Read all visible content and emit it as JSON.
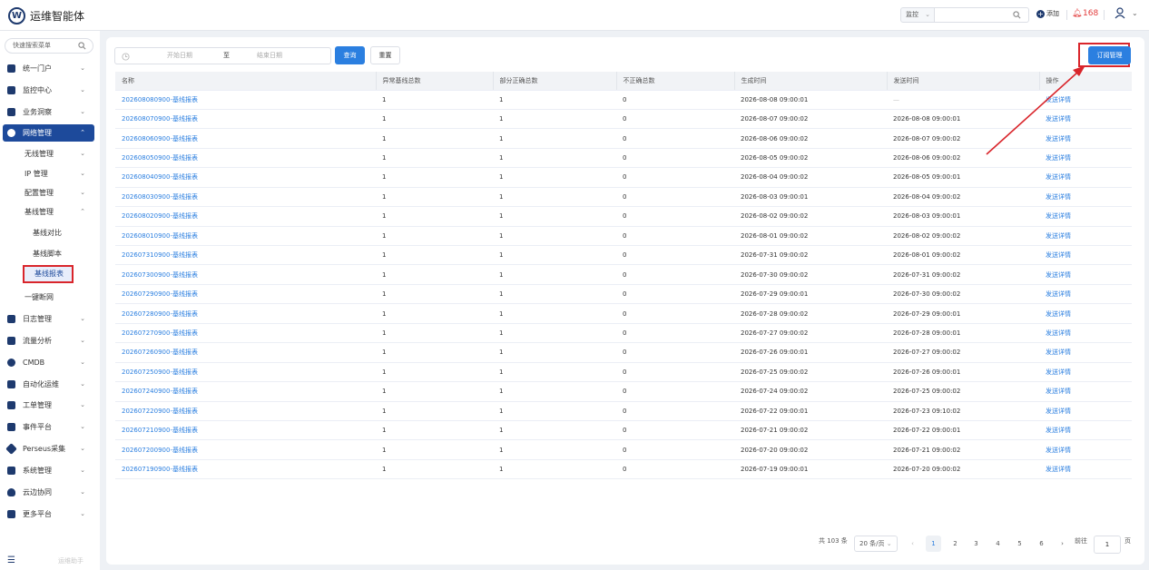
{
  "app": {
    "logo_letter": "W",
    "title": "运维智能体"
  },
  "header": {
    "monitor_select": "监控",
    "search_placeholder": "",
    "add_label": "添加",
    "alarm_count": "168"
  },
  "sidebar": {
    "search_placeholder": "快速搜索菜单",
    "items": [
      {
        "label": "统一门户"
      },
      {
        "label": "监控中心"
      },
      {
        "label": "业务洞察"
      },
      {
        "label": "网络管理"
      },
      {
        "label": "日志管理"
      },
      {
        "label": "流量分析"
      },
      {
        "label": "CMDB"
      },
      {
        "label": "自动化运维"
      },
      {
        "label": "工单管理"
      },
      {
        "label": "事件平台"
      },
      {
        "label": "Perseus采集"
      },
      {
        "label": "系统管理"
      },
      {
        "label": "云边协同"
      },
      {
        "label": "更多平台"
      }
    ],
    "network_sub": [
      {
        "label": "无线管理"
      },
      {
        "label": "IP 管理"
      },
      {
        "label": "配置管理"
      },
      {
        "label": "基线管理"
      }
    ],
    "baseline_sub": [
      {
        "label": "基线对比"
      },
      {
        "label": "基线脚本"
      },
      {
        "label": "基线报表"
      }
    ],
    "one_click": "一键断网",
    "bottom_text": "运维助手"
  },
  "filters": {
    "start_placeholder": "开始日期",
    "to_label": "至",
    "end_placeholder": "结束日期",
    "query_label": "查询",
    "reset_label": "重置",
    "subscribe_label": "订阅管理"
  },
  "table": {
    "headers": [
      "名称",
      "异常基线总数",
      "部分正确总数",
      "不正确总数",
      "生成时间",
      "发送时间",
      "操作"
    ],
    "rows": [
      [
        "202608080900-基线报表",
        "1",
        "1",
        "0",
        "2026-08-08 09:00:01",
        "—",
        "发送详情"
      ],
      [
        "202608070900-基线报表",
        "1",
        "1",
        "0",
        "2026-08-07 09:00:02",
        "2026-08-08 09:00:01",
        "发送详情"
      ],
      [
        "202608060900-基线报表",
        "1",
        "1",
        "0",
        "2026-08-06 09:00:02",
        "2026-08-07 09:00:02",
        "发送详情"
      ],
      [
        "202608050900-基线报表",
        "1",
        "1",
        "0",
        "2026-08-05 09:00:02",
        "2026-08-06 09:00:02",
        "发送详情"
      ],
      [
        "202608040900-基线报表",
        "1",
        "1",
        "0",
        "2026-08-04 09:00:02",
        "2026-08-05 09:00:01",
        "发送详情"
      ],
      [
        "202608030900-基线报表",
        "1",
        "1",
        "0",
        "2026-08-03 09:00:01",
        "2026-08-04 09:00:02",
        "发送详情"
      ],
      [
        "202608020900-基线报表",
        "1",
        "1",
        "0",
        "2026-08-02 09:00:02",
        "2026-08-03 09:00:01",
        "发送详情"
      ],
      [
        "202608010900-基线报表",
        "1",
        "1",
        "0",
        "2026-08-01 09:00:02",
        "2026-08-02 09:00:02",
        "发送详情"
      ],
      [
        "202607310900-基线报表",
        "1",
        "1",
        "0",
        "2026-07-31 09:00:02",
        "2026-08-01 09:00:02",
        "发送详情"
      ],
      [
        "202607300900-基线报表",
        "1",
        "1",
        "0",
        "2026-07-30 09:00:02",
        "2026-07-31 09:00:02",
        "发送详情"
      ],
      [
        "202607290900-基线报表",
        "1",
        "1",
        "0",
        "2026-07-29 09:00:01",
        "2026-07-30 09:00:02",
        "发送详情"
      ],
      [
        "202607280900-基线报表",
        "1",
        "1",
        "0",
        "2026-07-28 09:00:02",
        "2026-07-29 09:00:01",
        "发送详情"
      ],
      [
        "202607270900-基线报表",
        "1",
        "1",
        "0",
        "2026-07-27 09:00:02",
        "2026-07-28 09:00:01",
        "发送详情"
      ],
      [
        "202607260900-基线报表",
        "1",
        "1",
        "0",
        "2026-07-26 09:00:01",
        "2026-07-27 09:00:02",
        "发送详情"
      ],
      [
        "202607250900-基线报表",
        "1",
        "1",
        "0",
        "2026-07-25 09:00:02",
        "2026-07-26 09:00:01",
        "发送详情"
      ],
      [
        "202607240900-基线报表",
        "1",
        "1",
        "0",
        "2026-07-24 09:00:02",
        "2026-07-25 09:00:02",
        "发送详情"
      ],
      [
        "202607220900-基线报表",
        "1",
        "1",
        "0",
        "2026-07-22 09:00:01",
        "2026-07-23 09:10:02",
        "发送详情"
      ],
      [
        "202607210900-基线报表",
        "1",
        "1",
        "0",
        "2026-07-21 09:00:02",
        "2026-07-22 09:00:01",
        "发送详情"
      ],
      [
        "202607200900-基线报表",
        "1",
        "1",
        "0",
        "2026-07-20 09:00:02",
        "2026-07-21 09:00:02",
        "发送详情"
      ],
      [
        "202607190900-基线报表",
        "1",
        "1",
        "0",
        "2026-07-19 09:00:01",
        "2026-07-20 09:00:02",
        "发送详情"
      ]
    ]
  },
  "pagination": {
    "total": "共 103 条",
    "page_size": "20 条/页",
    "pages": [
      "1",
      "2",
      "3",
      "4",
      "5",
      "6"
    ],
    "current_page": "1",
    "goto_label": "前往",
    "goto_value": "1",
    "page_suffix": "页"
  },
  "colors": {
    "primary": "#2b7fe0",
    "nav_active": "#1d4a9b",
    "highlight": "#d9252b",
    "alarm": "#e23b3b"
  }
}
